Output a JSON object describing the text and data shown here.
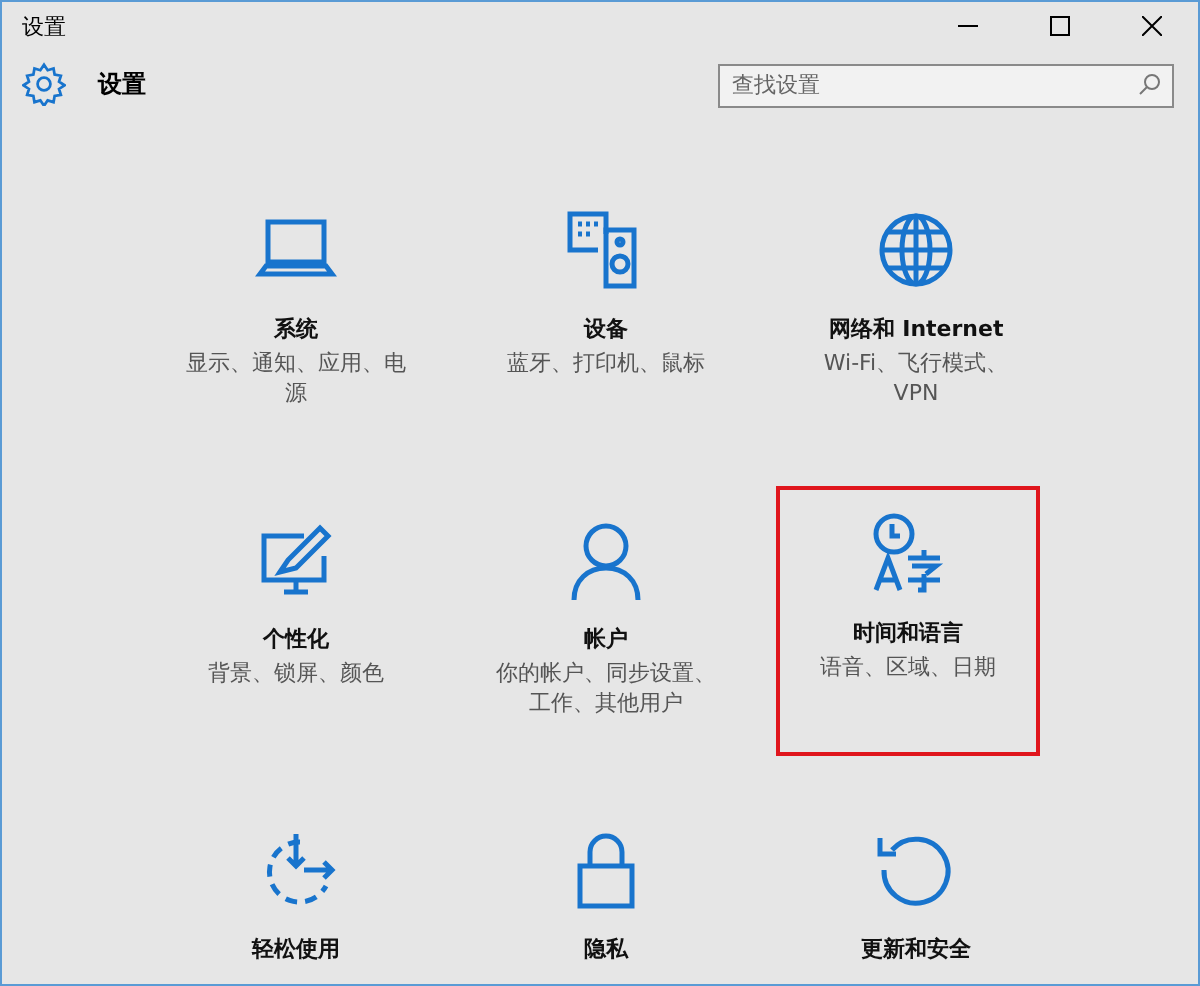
{
  "window": {
    "title": "设置"
  },
  "header": {
    "title": "设置"
  },
  "search": {
    "placeholder": "查找设置"
  },
  "tiles": [
    {
      "kind": "laptop",
      "title": "系统",
      "description": "显示、通知、应用、电源",
      "selected": false
    },
    {
      "kind": "devices",
      "title": "设备",
      "description": "蓝牙、打印机、鼠标",
      "selected": false
    },
    {
      "kind": "globe",
      "title": "网络和 Internet",
      "description": "Wi-Fi、飞行模式、VPN",
      "selected": false
    },
    {
      "kind": "paint",
      "title": "个性化",
      "description": "背景、锁屏、颜色",
      "selected": false
    },
    {
      "kind": "person",
      "title": "帐户",
      "description": "你的帐户、同步设置、工作、其他用户",
      "selected": false
    },
    {
      "kind": "language",
      "title": "时间和语言",
      "description": "语音、区域、日期",
      "selected": true
    },
    {
      "kind": "ease",
      "title": "轻松使用",
      "selected": false
    },
    {
      "kind": "lock",
      "title": "隐私",
      "selected": false
    },
    {
      "kind": "update",
      "title": "更新和安全",
      "selected": false
    }
  ]
}
